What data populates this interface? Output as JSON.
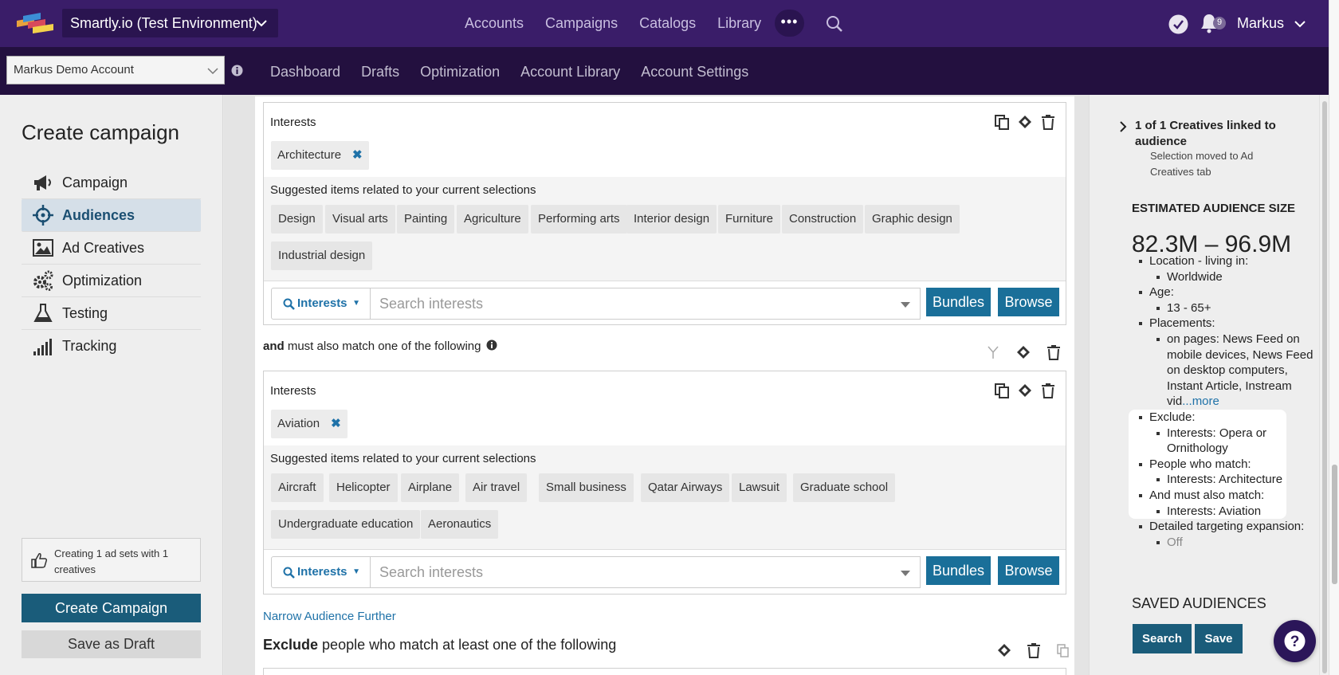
{
  "topbar": {
    "env_label": "Smartly.io (Test Environment)",
    "nav": [
      "Accounts",
      "Campaigns",
      "Catalogs",
      "Library"
    ],
    "more_label": "•••",
    "notification_count": "9",
    "user_name": "Markus"
  },
  "subbar": {
    "account": "Markus Demo Account",
    "nav": [
      "Dashboard",
      "Drafts",
      "Optimization",
      "Account Library",
      "Account Settings"
    ]
  },
  "left": {
    "title": "Create campaign",
    "menu": [
      {
        "label": "Campaign",
        "icon": "megaphone-icon"
      },
      {
        "label": "Audiences",
        "icon": "crosshair-icon",
        "active": true
      },
      {
        "label": "Ad Creatives",
        "icon": "image-icon"
      },
      {
        "label": "Optimization",
        "icon": "gears-icon"
      },
      {
        "label": "Testing",
        "icon": "flask-icon"
      },
      {
        "label": "Tracking",
        "icon": "signal-bars-icon"
      }
    ],
    "info_text": "Creating 1 ad sets with 1 creatives",
    "create_button": "Create Campaign",
    "draft_button": "Save as Draft"
  },
  "main": {
    "box1": {
      "label": "Interests",
      "tag": "Architecture",
      "suggestions_title": "Suggested items related to your current selections",
      "suggestions": [
        "Design",
        "Visual arts",
        "Painting",
        "Agriculture",
        "Performing arts",
        "Interior design",
        "Furniture",
        "Construction",
        "Graphic design",
        "Industrial design"
      ],
      "search_type": "Interests",
      "search_placeholder": "Search interests",
      "bundles": "Bundles",
      "browse": "Browse"
    },
    "and_prefix": "and",
    "and_text": "must also match one of the following",
    "box2": {
      "label": "Interests",
      "tag": "Aviation",
      "suggestions_title": "Suggested items related to your current selections",
      "suggestions": [
        "Aircraft",
        "Helicopter",
        "Airplane",
        "Air travel",
        "Small business",
        "Qatar Airways",
        "Lawsuit",
        "Graduate school",
        "Undergraduate education",
        "Aeronautics"
      ],
      "search_type": "Interests",
      "search_placeholder": "Search interests",
      "bundles": "Bundles",
      "browse": "Browse"
    },
    "narrow_link": "Narrow Audience Further",
    "exclude_prefix": "Exclude",
    "exclude_text": "people who match at least one of the following"
  },
  "right": {
    "creatives_link": "1 of 1 Creatives linked to audience",
    "creatives_sub": "Selection moved to Ad Creatives tab",
    "estimated_label": "ESTIMATED AUDIENCE SIZE",
    "size": "82.3M – 96.9M",
    "location_label": "Location - living in:",
    "location_value": "Worldwide",
    "age_label": "Age:",
    "age_value": "13 - 65+",
    "placements_label": "Placements:",
    "placements_value": "on pages: News Feed on mobile devices, News Feed on desktop computers, Instant Article, Instream vid",
    "more_link": "...more",
    "exclude_label": "Exclude:",
    "exclude_value": "Interests: Opera or Ornithology",
    "people_label": "People who match:",
    "people_value": "Interests: Architecture",
    "also_label": "And must also match:",
    "also_value": "Interests: Aviation",
    "expansion_label": "Detailed targeting expansion:",
    "expansion_value": "Off",
    "saved_label": "SAVED AUDIENCES",
    "search_button": "Search",
    "save_button": "Save"
  },
  "colors": {
    "topbar": "#3a1d69",
    "subbar": "#23103f",
    "primary_button": "#1a6f99",
    "link": "#1f72a8"
  }
}
